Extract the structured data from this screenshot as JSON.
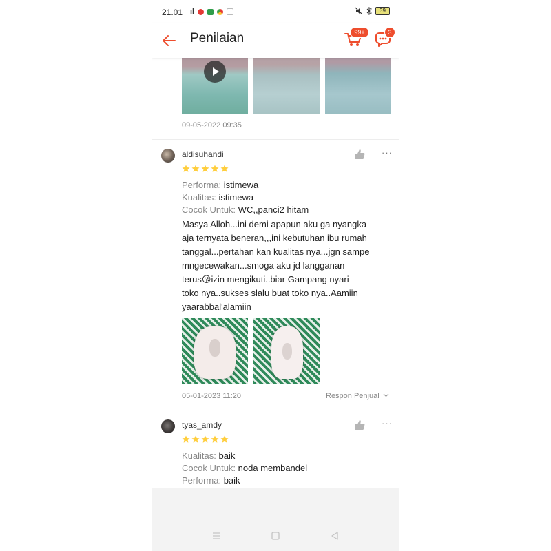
{
  "status_bar": {
    "time": "21.01",
    "signal_label": "ıl",
    "battery": "39"
  },
  "header": {
    "title": "Penilaian",
    "cart_badge": "99+",
    "chat_badge": "3"
  },
  "prev_review": {
    "date": "09-05-2022 09:35"
  },
  "reviews": [
    {
      "username": "aldisuhandi",
      "rating": 5,
      "attributes": [
        {
          "label": "Performa:",
          "value": "istimewa"
        },
        {
          "label": "Kualitas:",
          "value": "istimewa"
        },
        {
          "label": "Cocok Untuk:",
          "value": "WC,,panci2 hitam"
        }
      ],
      "body_lines": [
        "Masya Alloh...ini demi apapun aku ga nyangka",
        "aja ternyata beneran,,,ini kebutuhan ibu rumah",
        "tanggal...pertahan kan kualitas nya...jgn sampe",
        "mngecewakan...smoga aku jd langganan",
        "terus😘izin mengikuti..biar Gampang nyari",
        "toko nya..sukses slalu buat toko nya..Aamiin",
        "yaarabbal'alamiin"
      ],
      "date": "05-01-2023 11:20",
      "respon_label": "Respon Penjual"
    },
    {
      "username": "tyas_amdy",
      "rating": 5,
      "attributes": [
        {
          "label": "Kualitas:",
          "value": "baik"
        },
        {
          "label": "Cocok Untuk:",
          "value": "noda membandel"
        },
        {
          "label": "Performa:",
          "value": "baik"
        }
      ]
    }
  ],
  "colors": {
    "accent": "#ee4d2d",
    "star": "#ffce3d",
    "muted": "#888888"
  },
  "icons": [
    "back-arrow-icon",
    "cart-icon",
    "chat-icon",
    "play-icon",
    "star-icon",
    "thumbs-up-icon",
    "more-icon",
    "chevron-down-icon",
    "menu-icon",
    "home-icon",
    "back-nav-icon"
  ]
}
